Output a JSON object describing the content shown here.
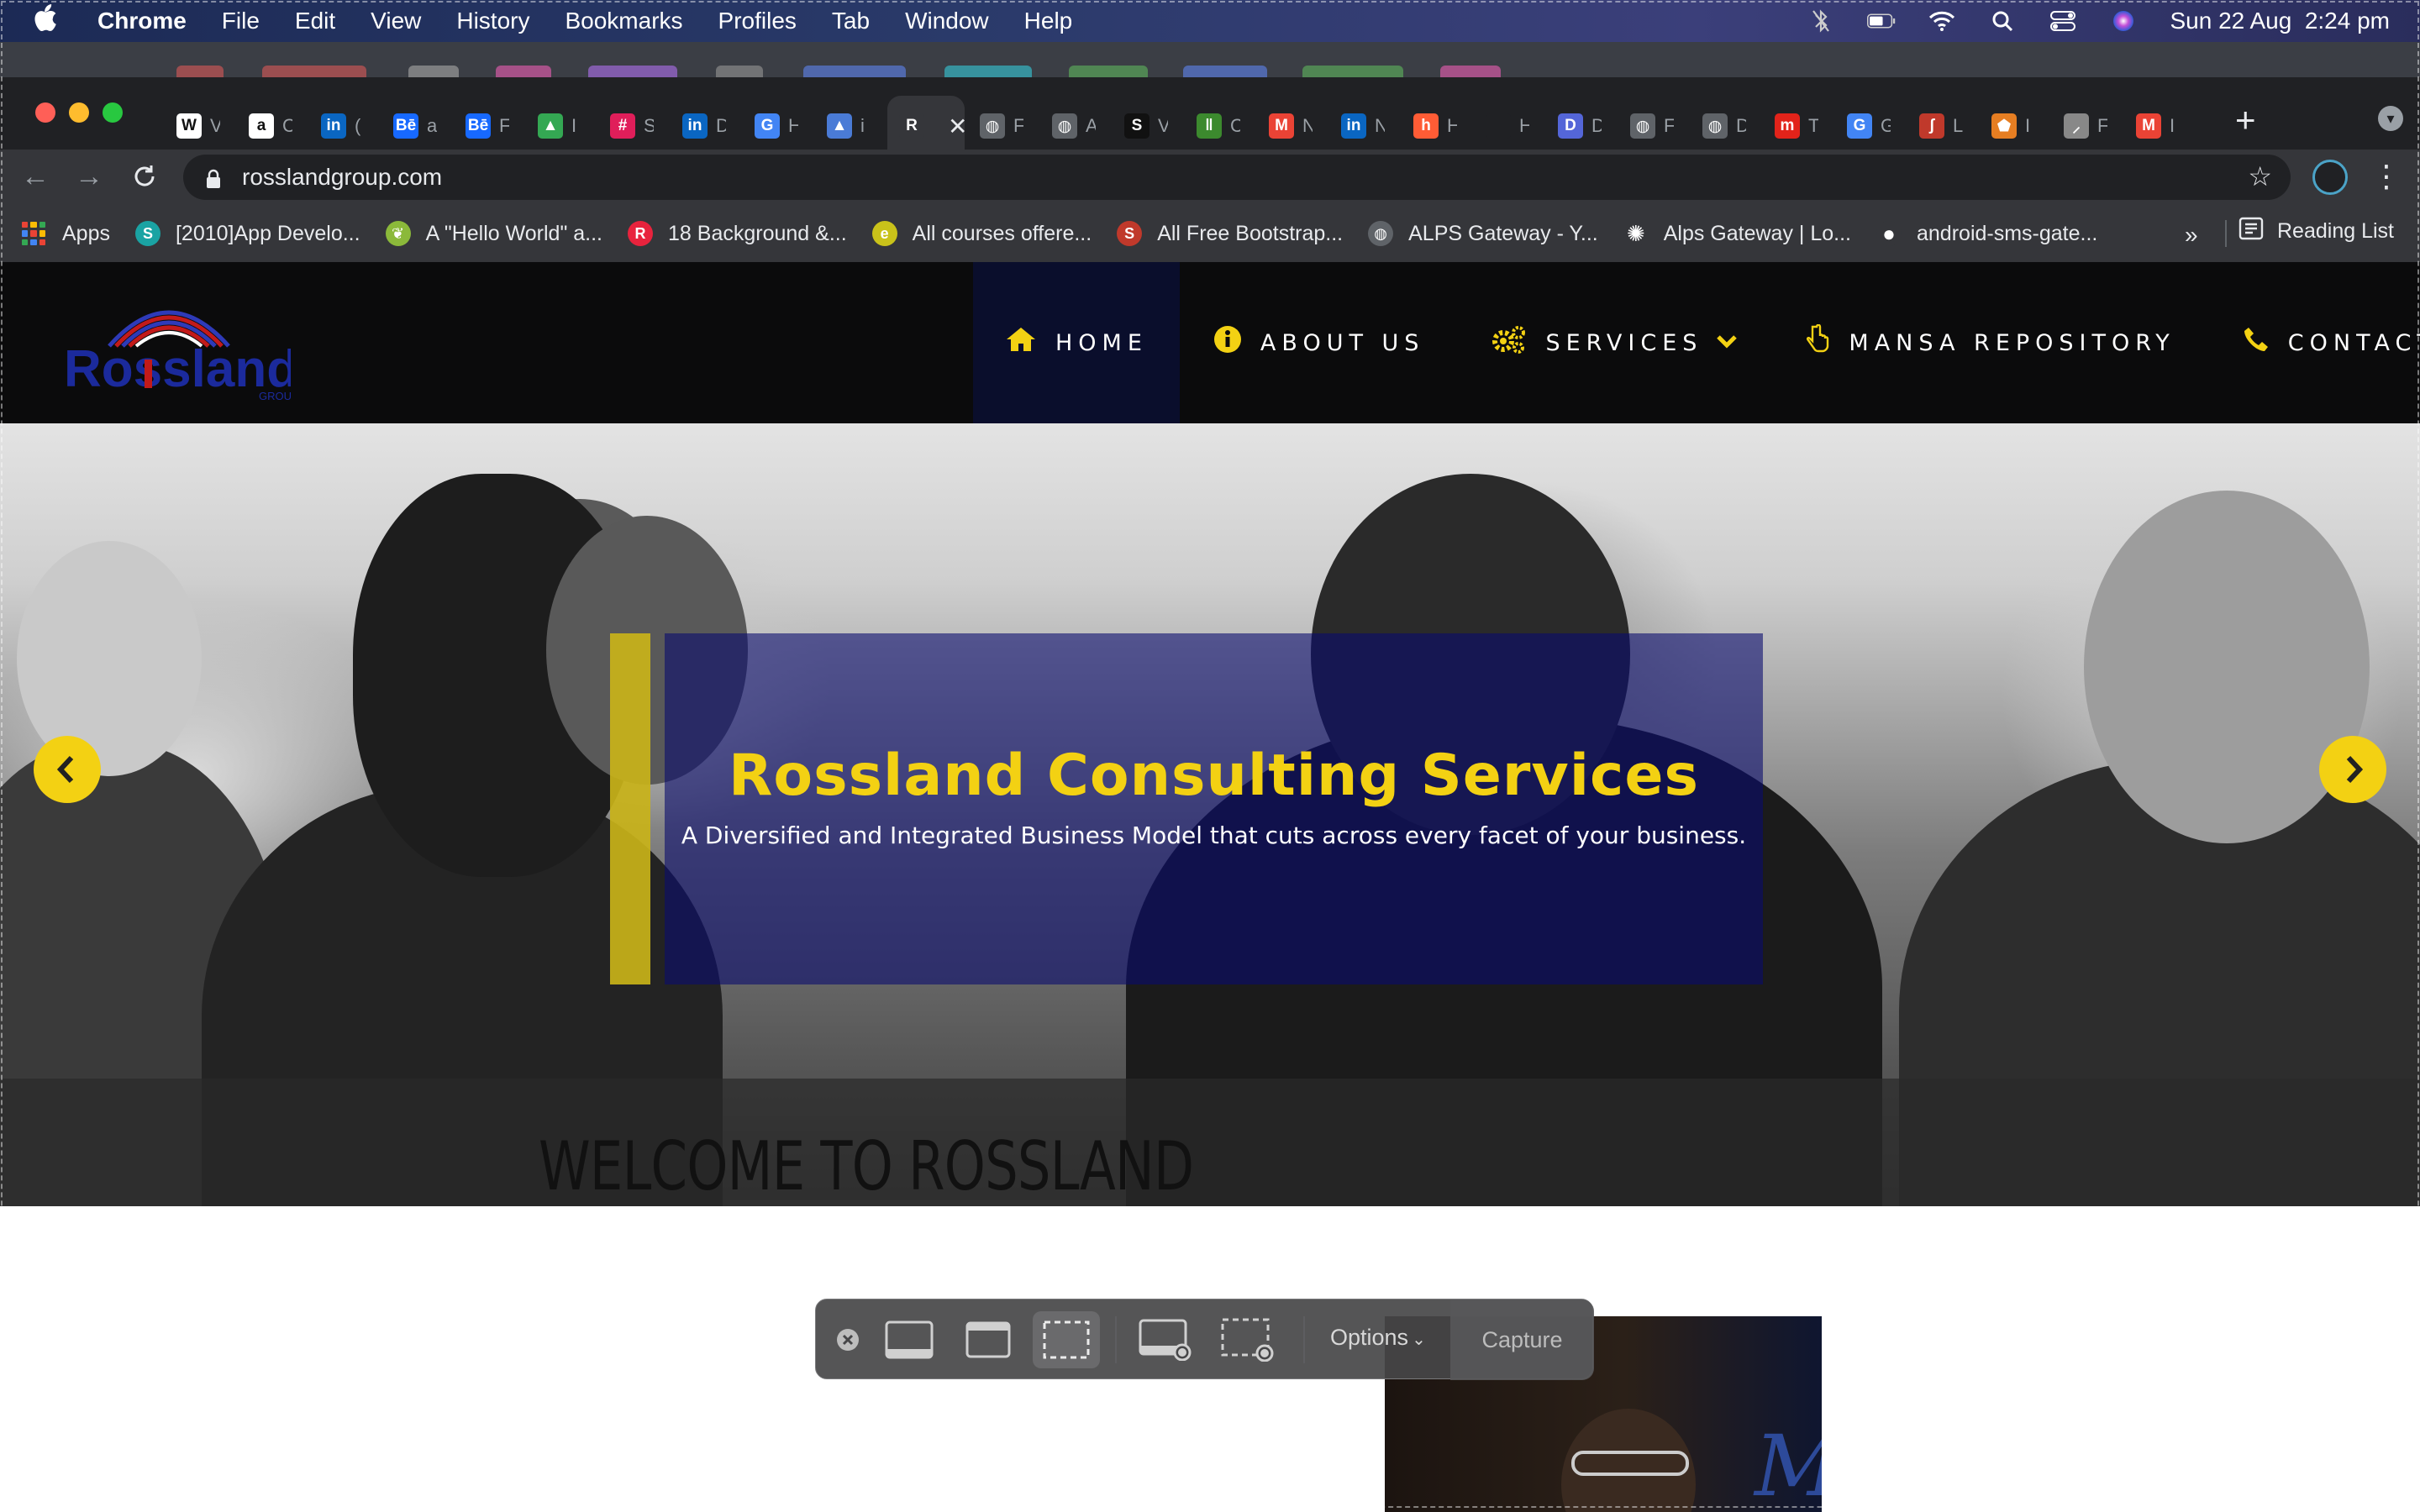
{
  "menubar": {
    "app_name": "Chrome",
    "menus": [
      "File",
      "Edit",
      "View",
      "History",
      "Bookmarks",
      "Profiles",
      "Tab",
      "Window",
      "Help"
    ],
    "datetime": "Sun 22 Aug  2:24 pm",
    "status_icons": [
      "bluetooth-off-icon",
      "battery-icon",
      "wifi-icon",
      "spotlight-search-icon",
      "control-center-icon",
      "siri-icon"
    ]
  },
  "browser": {
    "tabs": [
      {
        "icon": "wikipedia-favicon",
        "glyph": "W",
        "label": "V",
        "color": "#ffffff"
      },
      {
        "icon": "amazon-favicon",
        "glyph": "a",
        "label": "C",
        "color": "#ffffff"
      },
      {
        "icon": "linkedin-favicon",
        "glyph": "in",
        "label": "(",
        "color": "#0a66c2"
      },
      {
        "icon": "behance-favicon",
        "glyph": "Bē",
        "label": "a",
        "color": "#1769ff"
      },
      {
        "icon": "behance-favicon",
        "glyph": "Bē",
        "label": "F",
        "color": "#1769ff"
      },
      {
        "icon": "google-drive-favicon",
        "glyph": "▲",
        "label": "I",
        "color": "#34a853"
      },
      {
        "icon": "slack-favicon",
        "glyph": "#",
        "label": "S",
        "color": "#e01e5a"
      },
      {
        "icon": "linkedin-favicon",
        "glyph": "in",
        "label": "D",
        "color": "#0a66c2"
      },
      {
        "icon": "google-favicon",
        "glyph": "G",
        "label": "H",
        "color": "#4285f4"
      },
      {
        "icon": "triangle-favicon",
        "glyph": "▲",
        "label": "i",
        "color": "#4a7bd6"
      },
      {
        "icon": "",
        "glyph": "R",
        "label": "",
        "color": "#35363a"
      },
      {
        "icon": "globe-favicon",
        "glyph": "◍",
        "label": "F",
        "color": "#5f6368"
      },
      {
        "icon": "globe-favicon",
        "glyph": "◍",
        "label": "A",
        "color": "#5f6368"
      },
      {
        "icon": "dark-favicon",
        "glyph": "S",
        "label": "V",
        "color": "#111111"
      },
      {
        "icon": "bars-favicon",
        "glyph": "ǁ",
        "label": "C",
        "color": "#3c8a2e"
      },
      {
        "icon": "gmail-favicon",
        "glyph": "M",
        "label": "N",
        "color": "#ea4335"
      },
      {
        "icon": "linkedin-favicon",
        "glyph": "in",
        "label": "N",
        "color": "#0a66c2"
      },
      {
        "icon": "hubspot-favicon",
        "glyph": "h",
        "label": "H",
        "color": "#ff5c35"
      },
      {
        "icon": "blank-favicon",
        "glyph": "",
        "label": "H",
        "color": "#202124"
      },
      {
        "icon": "d-favicon",
        "glyph": "D",
        "label": "D",
        "color": "#5466d8"
      },
      {
        "icon": "globe-favicon",
        "glyph": "◍",
        "label": "F",
        "color": "#5f6368"
      },
      {
        "icon": "globe-favicon",
        "glyph": "◍",
        "label": "D",
        "color": "#5f6368"
      },
      {
        "icon": "m-favicon",
        "glyph": "m",
        "label": "T",
        "color": "#e2231a"
      },
      {
        "icon": "google-favicon",
        "glyph": "G",
        "label": "G",
        "color": "#4285f4"
      },
      {
        "icon": "bird-favicon",
        "glyph": "ʃ",
        "label": "L",
        "color": "#c0392b"
      },
      {
        "icon": "shield-favicon",
        "glyph": "⬟",
        "label": "I",
        "color": "#e67e22"
      },
      {
        "icon": "quill-favicon",
        "glyph": "⸝",
        "label": "F",
        "color": "#888888"
      },
      {
        "icon": "gmail-favicon",
        "glyph": "M",
        "label": "I",
        "color": "#ea4335"
      }
    ],
    "url": "rosslandgroup.com",
    "bookmarks": [
      {
        "label": "Apps",
        "icon": "apps-grid-icon",
        "color": ""
      },
      {
        "label": "[2010]App Develo...",
        "icon": "s-logo-icon",
        "glyph": "S",
        "color": "#1aa3a3"
      },
      {
        "label": "A \"Hello World\" a...",
        "icon": "leaf-icon",
        "glyph": "❦",
        "color": "#8bb93a"
      },
      {
        "label": "18 Background &...",
        "icon": "r-logo-icon",
        "glyph": "R",
        "color": "#e8233d"
      },
      {
        "label": "All courses offere...",
        "icon": "e-logo-icon",
        "glyph": "e",
        "color": "#c9c21a"
      },
      {
        "label": "All Free Bootstrap...",
        "icon": "s-square-icon",
        "glyph": "S",
        "color": "#c0392b"
      },
      {
        "label": "ALPS Gateway - Y...",
        "icon": "globe-icon",
        "glyph": "◍",
        "color": "#5f6368"
      },
      {
        "label": "Alps Gateway | Lo...",
        "icon": "pinwheel-icon",
        "glyph": "✺",
        "color": "#35363a"
      },
      {
        "label": "android-sms-gate...",
        "icon": "github-icon",
        "glyph": "●",
        "color": "#35363a"
      }
    ],
    "more": "»",
    "reading_list": "Reading List"
  },
  "site": {
    "logo_text": "Rossland",
    "logo_sub": "GROUP",
    "nav": [
      {
        "label": "HOME",
        "icon": "home-icon",
        "glyph": "⌂"
      },
      {
        "label": "ABOUT US",
        "icon": "info-icon",
        "glyph": "ℹ"
      },
      {
        "label": "SERVICES",
        "icon": "gears-icon",
        "glyph": "⚙"
      },
      {
        "label": "MANSA REPOSITORY",
        "icon": "pointer-hand-icon",
        "glyph": "☝"
      },
      {
        "label": "CONTACT",
        "icon": "phone-icon",
        "glyph": "✆"
      }
    ],
    "hero_title": "Rossland Consulting Services",
    "hero_subtitle": "A Diversified and Integrated Business Model that cuts across every facet of your business.",
    "welcome_heading": "WELCOME TO ROSSLAND"
  },
  "screenshot_toolbar": {
    "options_label": "Options",
    "capture_label": "Capture"
  },
  "colors": {
    "accent_yellow": "#f3d113",
    "overlay_navy": "#0a0c6e",
    "header_black": "#0b0b0c",
    "active_nav": "#0a0e2c",
    "logo_red": "#c21a1a",
    "logo_blue": "#1b2a9c"
  }
}
